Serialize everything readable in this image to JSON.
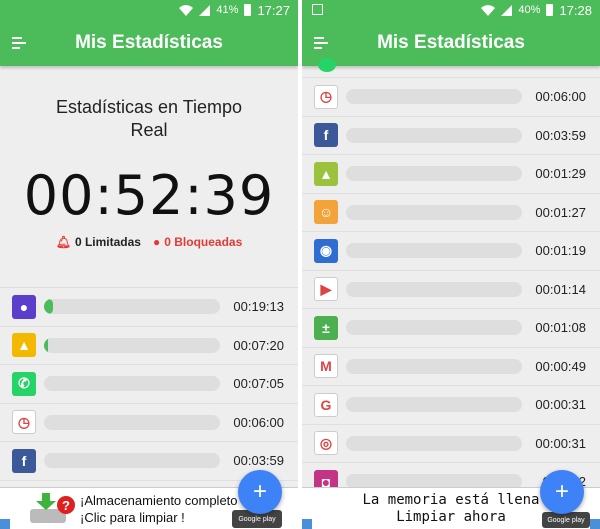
{
  "left": {
    "status": {
      "battery": "41%",
      "time": "17:27"
    },
    "title": "Mis Estadísticas",
    "realtime": {
      "title_line1": "Estadísticas en Tiempo",
      "title_line2": "Real",
      "clock": "00:52:39",
      "limited": "0 Limitadas",
      "blocked": "0 Bloqueadas"
    },
    "apps": [
      {
        "icon": "globe-icon",
        "color": "#5b3ecb",
        "glyph": "●",
        "fill": 0.05,
        "duration": "00:19:13"
      },
      {
        "icon": "gallery-icon",
        "color": "#f5b800",
        "glyph": "▲",
        "fill": 0.02,
        "duration": "00:07:20"
      },
      {
        "icon": "whatsapp-icon",
        "color": "#25d366",
        "glyph": "✆",
        "fill": 0,
        "duration": "00:07:05"
      },
      {
        "icon": "clock-icon",
        "color": "#ffffff",
        "glyph": "◷",
        "fill": 0,
        "duration": "00:06:00"
      },
      {
        "icon": "facebook-icon",
        "color": "#3b5998",
        "glyph": "f",
        "fill": 0,
        "duration": "00:03:59"
      }
    ],
    "ad": {
      "line1": "¡Almacenamiento completo ?",
      "line2": "¡Clic para limpiar !"
    }
  },
  "right": {
    "status": {
      "battery": "40%",
      "time": "17:28"
    },
    "title": "Mis Estadísticas",
    "apps": [
      {
        "icon": "clock-icon",
        "color": "#ffffff",
        "glyph": "◷",
        "fill": 0,
        "duration": "00:06:00"
      },
      {
        "icon": "facebook-icon",
        "color": "#3b5998",
        "glyph": "f",
        "fill": 0,
        "duration": "00:03:59"
      },
      {
        "icon": "plant-game-icon",
        "color": "#9bc23c",
        "glyph": "▲",
        "fill": 0,
        "duration": "00:01:29"
      },
      {
        "icon": "baby-app-icon",
        "color": "#f2a43a",
        "glyph": "☺",
        "fill": 0,
        "duration": "00:01:27"
      },
      {
        "icon": "camera-app-icon",
        "color": "#2f6dd3",
        "glyph": "◉",
        "fill": 0,
        "duration": "00:01:19"
      },
      {
        "icon": "play-store-icon",
        "color": "#ffffff",
        "glyph": "▶",
        "fill": 0,
        "duration": "00:01:14"
      },
      {
        "icon": "calculator-icon",
        "color": "#4caf50",
        "glyph": "±",
        "fill": 0,
        "duration": "00:01:08"
      },
      {
        "icon": "gmail-icon",
        "color": "#ffffff",
        "glyph": "M",
        "fill": 0,
        "duration": "00:00:49"
      },
      {
        "icon": "google-icon",
        "color": "#ffffff",
        "glyph": "G",
        "fill": 0,
        "duration": "00:00:31"
      },
      {
        "icon": "chrome-icon",
        "color": "#ffffff",
        "glyph": "◎",
        "fill": 0,
        "duration": "00:00:31"
      },
      {
        "icon": "instagram-icon",
        "color": "#c13584",
        "glyph": "◘",
        "fill": 0,
        "duration": "00:00:2"
      }
    ],
    "ad": {
      "line1": "La memoria está llena",
      "line2": "Limpiar ahora"
    }
  }
}
